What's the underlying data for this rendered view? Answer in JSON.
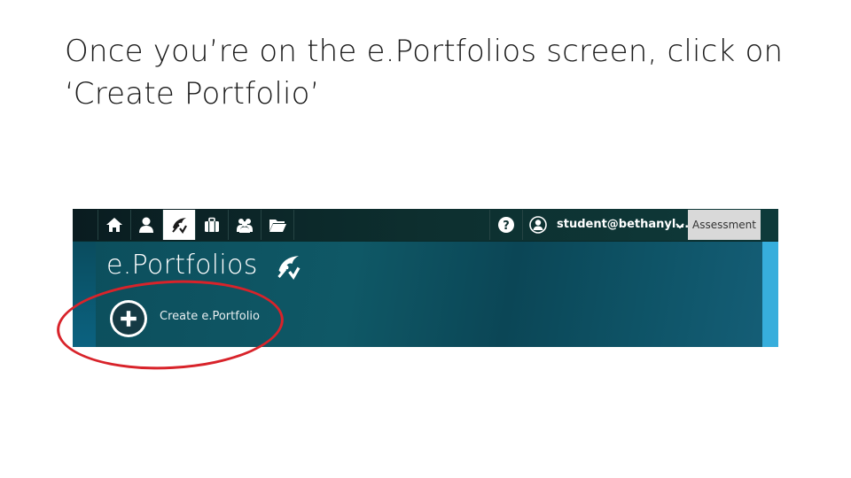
{
  "slide": {
    "title": "Once you’re on the e.Portfolios screen, click on ‘Create Portfolio’"
  },
  "topbar": {
    "nav_icons": [
      "home-icon",
      "user-icon",
      "eportfolio-icon",
      "briefcase-icon",
      "groups-icon",
      "folder-icon"
    ],
    "active_icon": "eportfolio-icon",
    "help_icon": "question-icon",
    "account_icon": "user-circle-icon",
    "user": "student@bethanyl...",
    "assessment": "Assessment"
  },
  "main": {
    "heading": "e.Portfolios",
    "create_label": "Create e.Portfolio"
  },
  "annotation": {
    "color": "#d8232a"
  },
  "colors": {
    "topbar": "#0d2f2f",
    "panel": "#0f5866",
    "right_accent": "#37aedc",
    "assessment_bg": "#d9d9d9"
  }
}
